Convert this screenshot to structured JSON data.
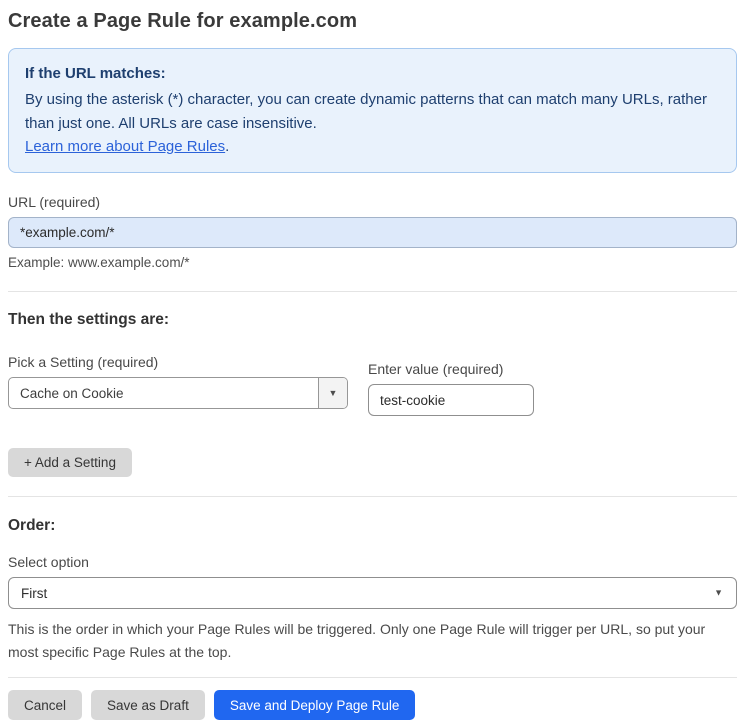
{
  "page": {
    "title": "Create a Page Rule for example.com"
  },
  "info_box": {
    "heading": "If the URL matches:",
    "body": "By using the asterisk (*) character, you can create dynamic patterns that can match many URLs, rather than just one. All URLs are case insensitive.",
    "link_label": "Learn more about Page Rules",
    "link_suffix": "."
  },
  "url_field": {
    "label": "URL (required)",
    "value": "*example.com/*",
    "helper": "Example: www.example.com/*"
  },
  "settings_section": {
    "heading": "Then the settings are:",
    "setting_label": "Pick a Setting (required)",
    "setting_value": "Cache on Cookie",
    "value_label": "Enter value (required)",
    "value_value": "test-cookie",
    "add_button_label": "+ Add a Setting"
  },
  "order_section": {
    "heading": "Order:",
    "select_label": "Select option",
    "select_value": "First",
    "helper": "This is the order in which your Page Rules will be triggered. Only one Page Rule will trigger per URL, so put your most specific Page Rules at the top."
  },
  "actions": {
    "cancel_label": "Cancel",
    "save_draft_label": "Save as Draft",
    "save_deploy_label": "Save and Deploy Page Rule"
  },
  "icons": {
    "dropdown_arrow": "▼"
  },
  "colors": {
    "info_box_bg": "#e9f2fc",
    "info_box_border": "#a6c8ef",
    "info_text": "#1e3f6f",
    "link_blue": "#2b62d9",
    "url_input_bg": "#dde9fa",
    "primary_button_blue": "#2067f0",
    "gray_button": "#d8d8d8"
  }
}
